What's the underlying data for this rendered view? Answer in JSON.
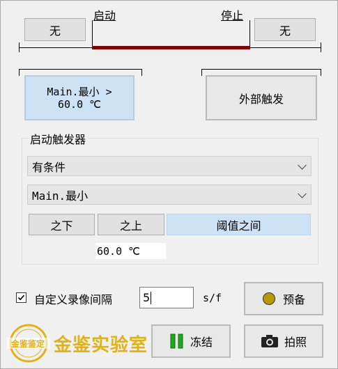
{
  "trigger": {
    "start_label": "启动",
    "stop_label": "停止",
    "start_none": "无",
    "stop_none": "无",
    "start_source_line1": "Main.最小 >",
    "start_source_line2": "60.0 ℃",
    "stop_source": "外部触发"
  },
  "start_trigger_group": {
    "title": "启动触发器",
    "condition_select": "有条件",
    "source_select": "Main.最小",
    "modes": [
      "之下",
      "之上",
      "阈值之间"
    ],
    "threshold_value": "60.0 ℃"
  },
  "recording": {
    "custom_interval_label": "自定义录像间隔",
    "interval_value": "5",
    "unit": "s/f",
    "checked": true
  },
  "actions": {
    "arm": "预备",
    "freeze": "冻结",
    "snapshot": "拍照"
  },
  "watermark": {
    "seal_text": "金鉴鉴定",
    "text": "金鉴实验室"
  },
  "colors": {
    "timeline_bar": "#7a0000",
    "arm_dot": "#b59a06",
    "freeze_icon": "#1ea91e",
    "watermark": "#e0b21a"
  }
}
